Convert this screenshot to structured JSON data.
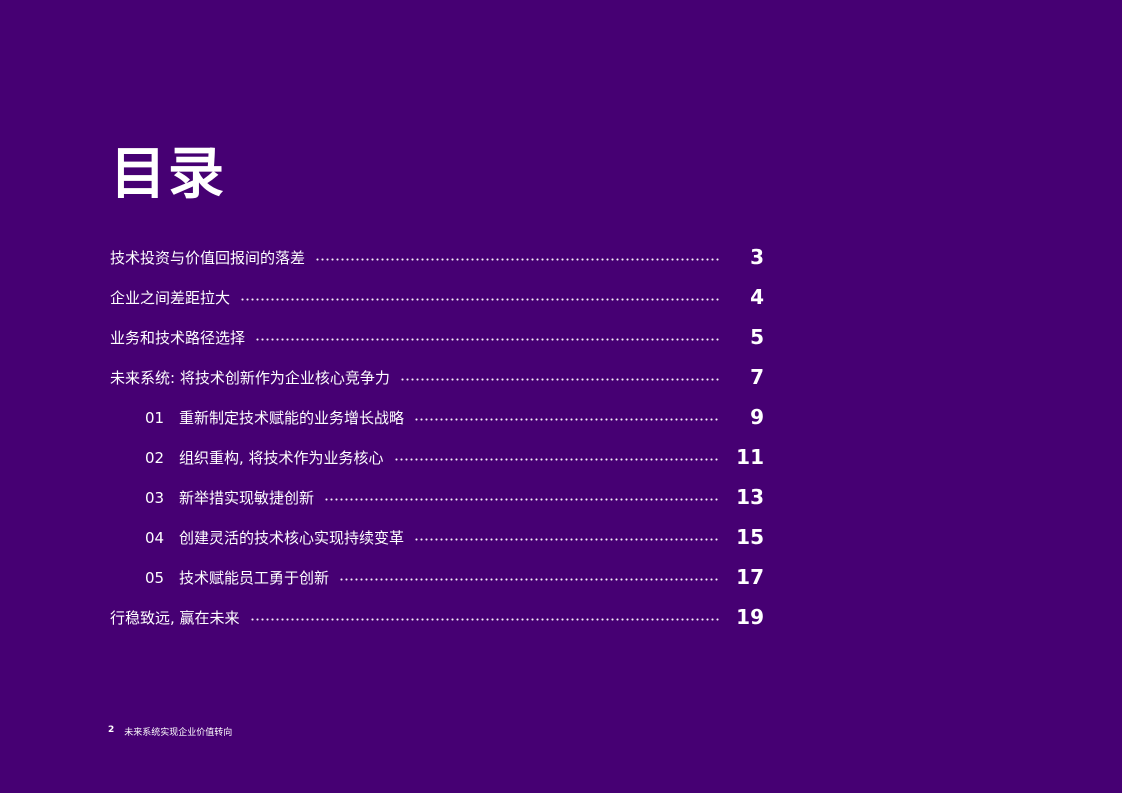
{
  "title": "目录",
  "toc": [
    {
      "number": "",
      "label": "技术投资与价值回报间的落差",
      "page": "3",
      "level": 1
    },
    {
      "number": "",
      "label": "企业之间差距拉大",
      "page": "4",
      "level": 1
    },
    {
      "number": "",
      "label": "业务和技术路径选择",
      "page": "5",
      "level": 1
    },
    {
      "number": "",
      "label": "未来系统: 将技术创新作为企业核心竞争力",
      "page": "7",
      "level": 1
    },
    {
      "number": "01",
      "label": "重新制定技术赋能的业务增长战略",
      "page": "9",
      "level": 2
    },
    {
      "number": "02",
      "label": "组织重构, 将技术作为业务核心",
      "page": "11",
      "level": 2
    },
    {
      "number": "03",
      "label": "新举措实现敏捷创新",
      "page": "13",
      "level": 2
    },
    {
      "number": "04",
      "label": "创建灵活的技术核心实现持续变革",
      "page": "15",
      "level": 2
    },
    {
      "number": "05",
      "label": "技术赋能员工勇于创新",
      "page": "17",
      "level": 2
    },
    {
      "number": "",
      "label": "行稳致远, 赢在未来",
      "page": "19",
      "level": 1
    }
  ],
  "footer": {
    "page": "2",
    "text": "未来系统实现企业价值转向"
  },
  "colors": {
    "background": "#460073",
    "text": "#ffffff"
  }
}
